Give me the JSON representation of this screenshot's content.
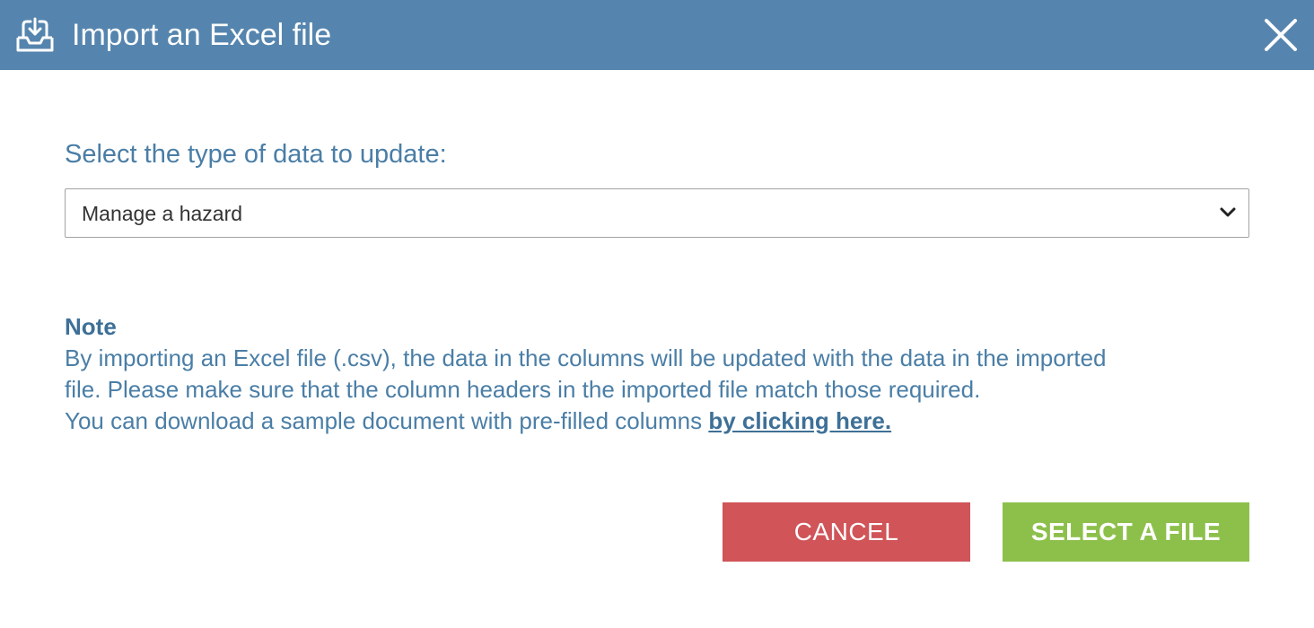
{
  "dialog": {
    "title": "Import an Excel file",
    "title_icon": "inbox-download-icon",
    "close_icon": "close-icon"
  },
  "form": {
    "label": "Select the type of data to update:",
    "select_value": "Manage a hazard",
    "select_icon": "chevron-down-icon"
  },
  "note": {
    "title": "Note",
    "line1": "By importing an Excel file (.csv), the data in the columns will be updated with the data in the imported",
    "line2": "file. Please make sure that the column headers in the imported file match those required.",
    "line3_prefix": "You can download a sample document with pre-filled columns ",
    "link_text": "by clicking here."
  },
  "buttons": {
    "cancel_label": "CANCEL",
    "select_file_label": "SELECT A FILE"
  },
  "colors": {
    "titlebar": "#5585ae",
    "text_blue": "#4a7ea6",
    "cancel": "#d05458",
    "select_file": "#8dc04b"
  }
}
